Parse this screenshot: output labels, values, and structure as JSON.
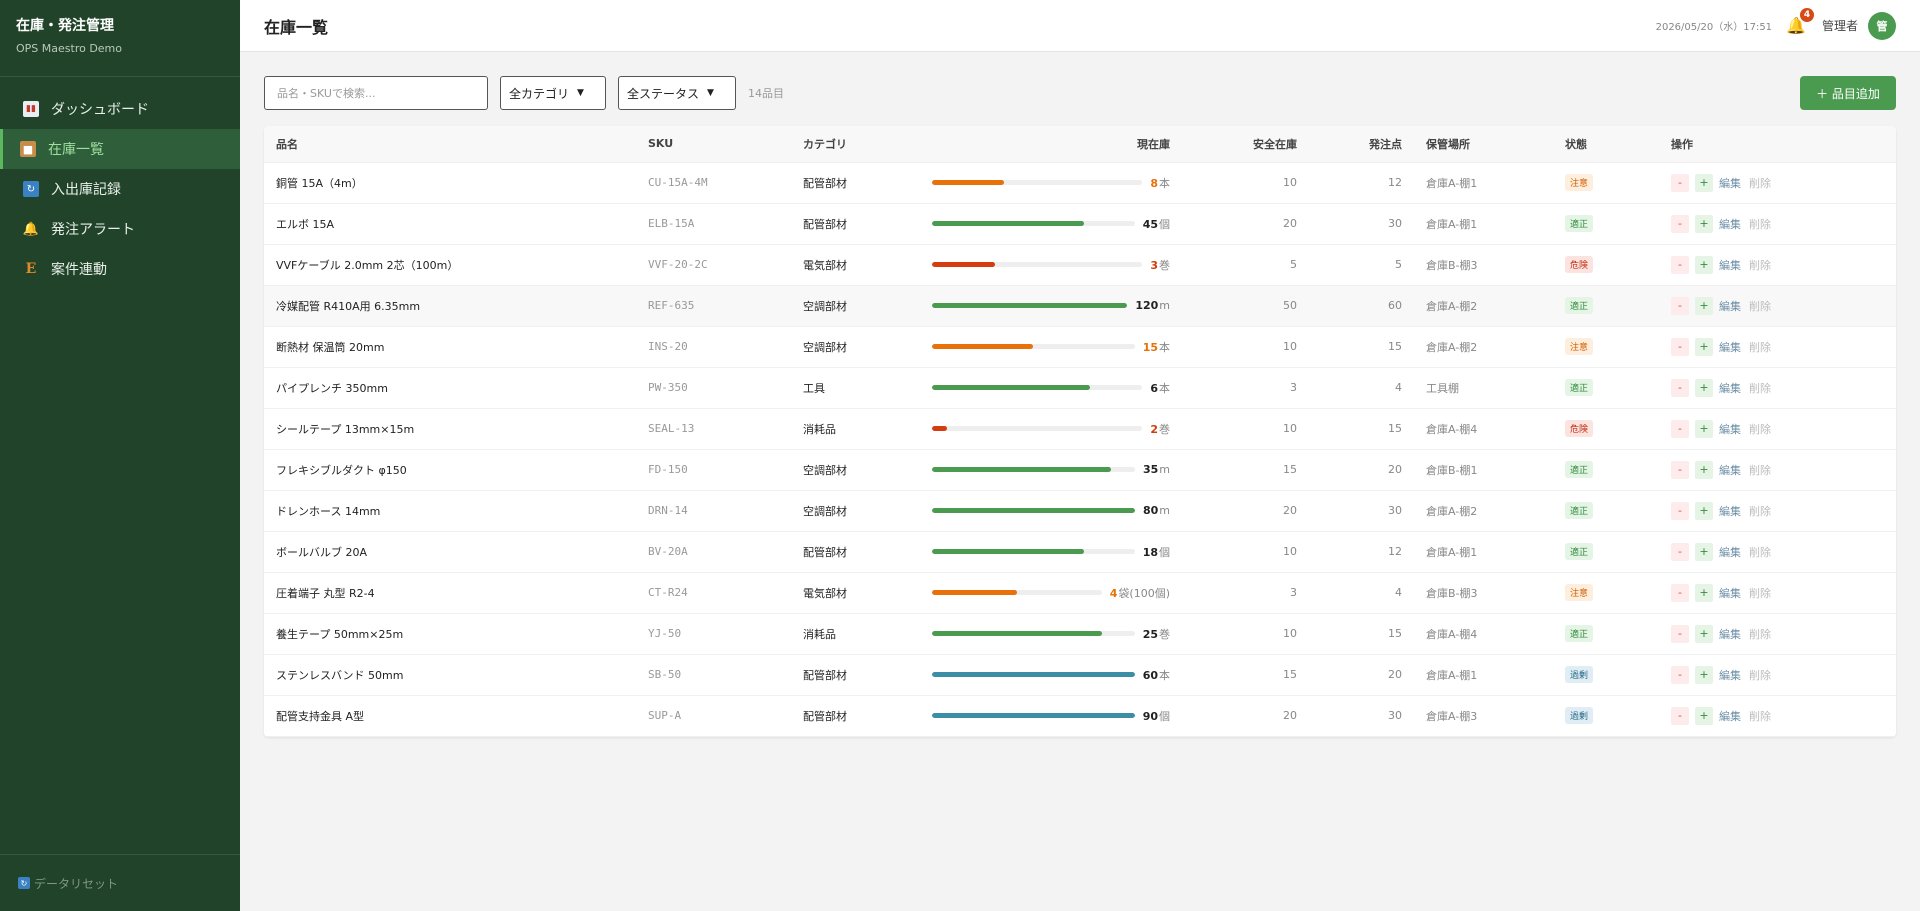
{
  "brand": {
    "title": "在庫・発注管理",
    "subtitle": "OPS Maestro Demo"
  },
  "nav": [
    {
      "label": "ダッシュボード",
      "icon": "chart-icon",
      "active": false
    },
    {
      "label": "在庫一覧",
      "icon": "box-icon",
      "active": true
    },
    {
      "label": "入出庫記録",
      "icon": "sync-icon",
      "active": false
    },
    {
      "label": "発注アラート",
      "icon": "bell-icon",
      "active": false
    },
    {
      "label": "案件連動",
      "icon": "e-icon",
      "active": false
    }
  ],
  "sidebar_footer": {
    "label": "データリセット"
  },
  "header": {
    "title": "在庫一覧",
    "datetime": "2026/05/20（水）17:51",
    "notifications": "4",
    "user": "管理者",
    "avatar": "管"
  },
  "toolbar": {
    "search_placeholder": "品名・SKUで検索...",
    "category_selected": "全カテゴリ",
    "status_selected": "全ステータス",
    "count": "14品目",
    "add_label": "＋ 品目追加"
  },
  "table": {
    "headers": {
      "name": "品名",
      "sku": "SKU",
      "category": "カテゴリ",
      "stock": "現在庫",
      "safety": "安全在庫",
      "reorder": "発注点",
      "location": "保管場所",
      "status": "状態",
      "ops": "操作"
    },
    "ops_labels": {
      "minus": "-",
      "plus": "+",
      "edit": "編集",
      "delete": "削除"
    },
    "rows": [
      {
        "name": "銅管 15A（4m）",
        "sku": "CU-15A-4M",
        "category": "配管部材",
        "stock": "8",
        "unit": "本",
        "level": 0.34,
        "safety": "10",
        "reorder": "12",
        "location": "倉庫A-棚1",
        "status": "注意",
        "status_type": "caution"
      },
      {
        "name": "エルボ 15A",
        "sku": "ELB-15A",
        "category": "配管部材",
        "stock": "45",
        "unit": "個",
        "level": 0.75,
        "safety": "20",
        "reorder": "30",
        "location": "倉庫A-棚1",
        "status": "適正",
        "status_type": "ok"
      },
      {
        "name": "VVFケーブル 2.0mm 2芯（100m）",
        "sku": "VVF-20-2C",
        "category": "電気部材",
        "stock": "3",
        "unit": "巻",
        "level": 0.3,
        "safety": "5",
        "reorder": "5",
        "location": "倉庫B-棚3",
        "status": "危険",
        "status_type": "danger"
      },
      {
        "name": "冷媒配管 R410A用 6.35mm",
        "sku": "REF-635",
        "category": "空調部材",
        "stock": "120",
        "unit": "m",
        "level": 1.0,
        "safety": "50",
        "reorder": "60",
        "location": "倉庫A-棚2",
        "status": "適正",
        "status_type": "ok"
      },
      {
        "name": "断熱材 保温筒 20mm",
        "sku": "INS-20",
        "category": "空調部材",
        "stock": "15",
        "unit": "本",
        "level": 0.5,
        "safety": "10",
        "reorder": "15",
        "location": "倉庫A-棚2",
        "status": "注意",
        "status_type": "caution"
      },
      {
        "name": "パイプレンチ 350mm",
        "sku": "PW-350",
        "category": "工具",
        "stock": "6",
        "unit": "本",
        "level": 0.75,
        "safety": "3",
        "reorder": "4",
        "location": "工具棚",
        "status": "適正",
        "status_type": "ok"
      },
      {
        "name": "シールテープ 13mm×15m",
        "sku": "SEAL-13",
        "category": "消耗品",
        "stock": "2",
        "unit": "巻",
        "level": 0.07,
        "safety": "10",
        "reorder": "15",
        "location": "倉庫A-棚4",
        "status": "危険",
        "status_type": "danger"
      },
      {
        "name": "フレキシブルダクト φ150",
        "sku": "FD-150",
        "category": "空調部材",
        "stock": "35",
        "unit": "m",
        "level": 0.88,
        "safety": "15",
        "reorder": "20",
        "location": "倉庫B-棚1",
        "status": "適正",
        "status_type": "ok"
      },
      {
        "name": "ドレンホース 14mm",
        "sku": "DRN-14",
        "category": "空調部材",
        "stock": "80",
        "unit": "m",
        "level": 1.0,
        "safety": "20",
        "reorder": "30",
        "location": "倉庫A-棚2",
        "status": "適正",
        "status_type": "ok"
      },
      {
        "name": "ボールバルブ 20A",
        "sku": "BV-20A",
        "category": "配管部材",
        "stock": "18",
        "unit": "個",
        "level": 0.75,
        "safety": "10",
        "reorder": "12",
        "location": "倉庫A-棚1",
        "status": "適正",
        "status_type": "ok"
      },
      {
        "name": "圧着端子 丸型 R2-4",
        "sku": "CT-R24",
        "category": "電気部材",
        "stock": "4",
        "unit": "袋(100個)",
        "level": 0.5,
        "safety": "3",
        "reorder": "4",
        "location": "倉庫B-棚3",
        "status": "注意",
        "status_type": "caution"
      },
      {
        "name": "養生テープ 50mm×25m",
        "sku": "YJ-50",
        "category": "消耗品",
        "stock": "25",
        "unit": "巻",
        "level": 0.84,
        "safety": "10",
        "reorder": "15",
        "location": "倉庫A-棚4",
        "status": "適正",
        "status_type": "ok"
      },
      {
        "name": "ステンレスバンド 50mm",
        "sku": "SB-50",
        "category": "配管部材",
        "stock": "60",
        "unit": "本",
        "level": 1.0,
        "safety": "15",
        "reorder": "20",
        "location": "倉庫A-棚1",
        "status": "過剰",
        "status_type": "excess"
      },
      {
        "name": "配管支持金具 A型",
        "sku": "SUP-A",
        "category": "配管部材",
        "stock": "90",
        "unit": "個",
        "level": 1.0,
        "safety": "20",
        "reorder": "30",
        "location": "倉庫A-棚3",
        "status": "過剰",
        "status_type": "excess"
      }
    ]
  },
  "colors": {
    "caution": "#e8710a",
    "ok": "#4a9a4f",
    "danger": "#d43d0f",
    "excess": "#3b8ea5",
    "sidebar": "#21432a",
    "accent": "#4a9a4f"
  }
}
